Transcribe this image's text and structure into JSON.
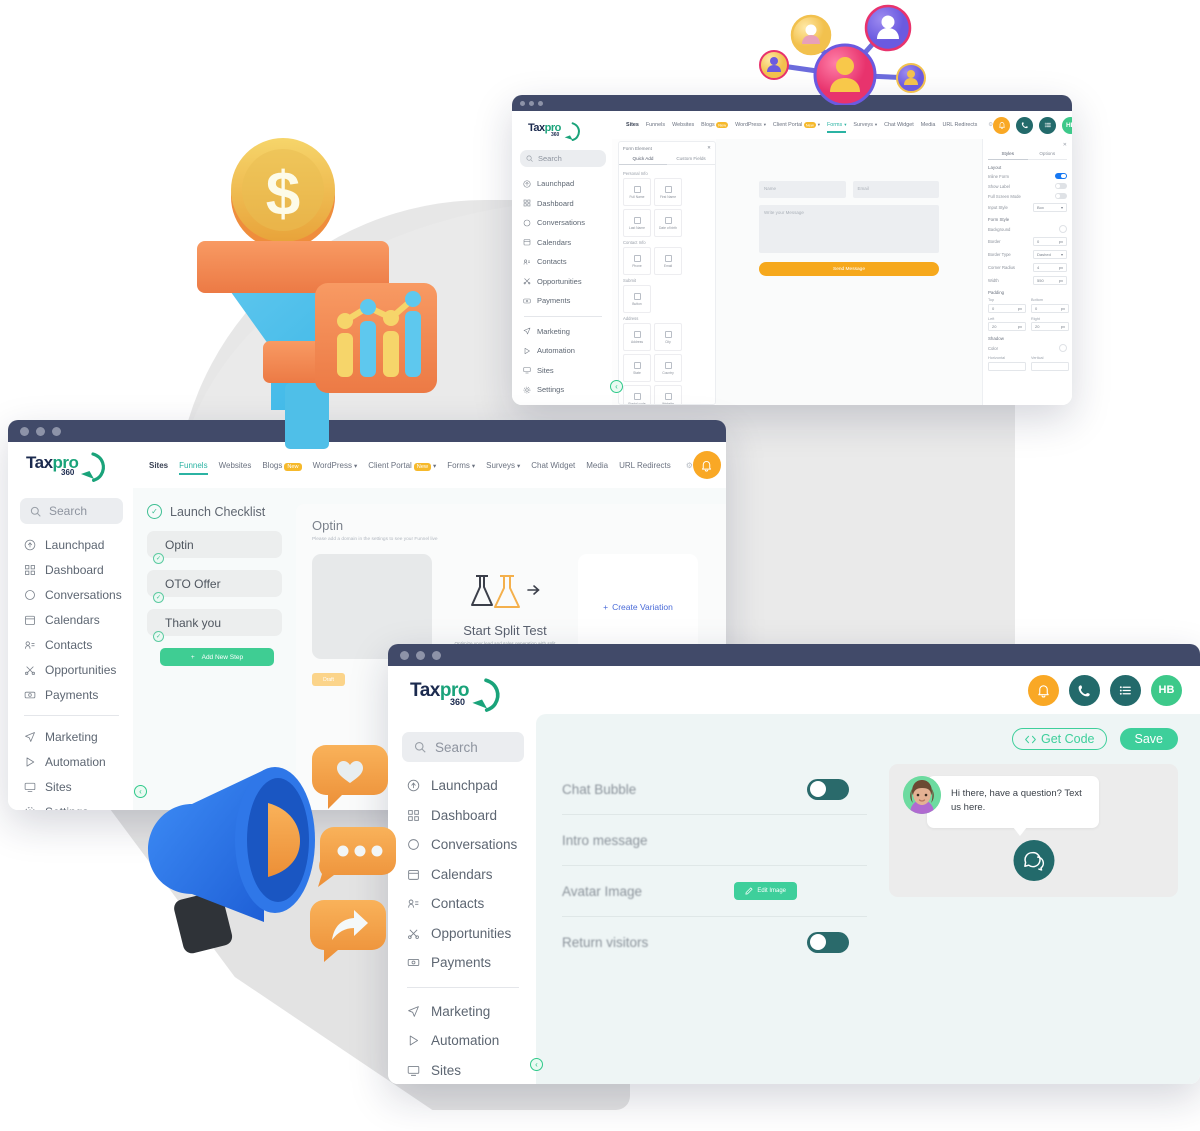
{
  "brand": {
    "logo_tax": "Tax",
    "logo_pro": "pro",
    "logo_num": "360",
    "accent_green": "#3ecf9b",
    "accent_teal": "#236a6b",
    "accent_orange": "#f9a825",
    "titlebar": "#414a69"
  },
  "sidebar": {
    "search_placeholder": "Search",
    "items": [
      {
        "label": "Launchpad",
        "icon": "rocket-icon"
      },
      {
        "label": "Dashboard",
        "icon": "grid-icon"
      },
      {
        "label": "Conversations",
        "icon": "chat-icon"
      },
      {
        "label": "Calendars",
        "icon": "calendar-icon"
      },
      {
        "label": "Contacts",
        "icon": "contacts-icon"
      },
      {
        "label": "Opportunities",
        "icon": "opportunities-icon"
      },
      {
        "label": "Payments",
        "icon": "payments-icon"
      }
    ],
    "items2": [
      {
        "label": "Marketing",
        "icon": "send-icon"
      },
      {
        "label": "Automation",
        "icon": "play-icon"
      },
      {
        "label": "Sites",
        "icon": "monitor-icon"
      },
      {
        "label": "Settings",
        "icon": "gear-icon"
      }
    ],
    "collapse_icon": "chevron-left-icon"
  },
  "header": {
    "bell_icon": "bell-icon",
    "phone_icon": "phone-icon",
    "list_icon": "list-icon",
    "avatar_initials": "HB"
  },
  "site_tabs": [
    {
      "label": "Sites",
      "state": "bold"
    },
    {
      "label": "Funnels",
      "state": "active"
    },
    {
      "label": "Websites",
      "state": "normal"
    },
    {
      "label": "Blogs",
      "state": "normal",
      "badge": "New"
    },
    {
      "label": "WordPress",
      "state": "normal",
      "caret": true
    },
    {
      "label": "Client Portal",
      "state": "normal",
      "badge": "New",
      "caret": true
    },
    {
      "label": "Forms",
      "state": "normal",
      "caret": true
    },
    {
      "label": "Surveys",
      "state": "normal",
      "caret": true
    },
    {
      "label": "Chat Widget",
      "state": "normal"
    },
    {
      "label": "Media",
      "state": "normal"
    },
    {
      "label": "URL Redirects",
      "state": "normal"
    }
  ],
  "site_tabs_back": [
    {
      "label": "Sites",
      "state": "bold"
    },
    {
      "label": "Funnels",
      "state": "normal"
    },
    {
      "label": "Websites",
      "state": "normal"
    },
    {
      "label": "Blogs",
      "state": "normal",
      "badge": "New"
    },
    {
      "label": "WordPress",
      "state": "normal",
      "caret": true
    },
    {
      "label": "Client Portal",
      "state": "normal",
      "badge": "New",
      "caret": true
    },
    {
      "label": "Forms",
      "state": "active",
      "caret": true
    },
    {
      "label": "Surveys",
      "state": "normal",
      "caret": true
    },
    {
      "label": "Chat Widget",
      "state": "normal"
    },
    {
      "label": "Media",
      "state": "normal"
    },
    {
      "label": "URL Redirects",
      "state": "normal"
    }
  ],
  "funnel_window": {
    "checklist_title": "Launch Checklist",
    "steps": [
      {
        "label": "Optin"
      },
      {
        "label": "OTO Offer"
      },
      {
        "label": "Thank you"
      }
    ],
    "add_step_label": "Add New Step",
    "add_step_icon": "plus-icon",
    "page_title": "Optin",
    "page_subtitle": "Please add a domain in the settings to see your Funnel live",
    "split_title": "Start Split Test",
    "split_sub": "Optimize your lead and sales generation with split tests",
    "create_variation": "Create Variation",
    "create_variation_icon": "plus-icon",
    "tag_label": "Draft",
    "split_arrow_icon": "arrow-right-icon",
    "flask_icon": "flask-icon"
  },
  "form_builder": {
    "panel_title": "Form Element",
    "close_icon": "close-icon",
    "tabs": [
      "Quick Add",
      "Custom Fields"
    ],
    "active_tab": "Quick Add",
    "sections": [
      {
        "name": "Personal Info",
        "fields": [
          "Full Name",
          "First Name",
          "Last Name",
          "Date of birth"
        ]
      },
      {
        "name": "Contact Info",
        "fields": [
          "Phone",
          "Email"
        ]
      },
      {
        "name": "Submit",
        "fields": [
          "Button"
        ]
      },
      {
        "name": "Address",
        "fields": [
          "Address",
          "City",
          "State",
          "Country",
          "Postal code",
          "Website"
        ]
      }
    ],
    "preview": {
      "name_placeholder": "Name",
      "email_placeholder": "Email",
      "message_placeholder": "Write your Message",
      "submit_label": "Send Message"
    },
    "styles_panel": {
      "tabs": [
        "Styles",
        "Options"
      ],
      "active_tab": "Styles",
      "layout_heading": "Layout",
      "layout_rows": [
        {
          "label": "Inline Form",
          "type": "switch",
          "value": "on"
        },
        {
          "label": "Show Label",
          "type": "switch",
          "value": "off"
        },
        {
          "label": "Full Screen Mode",
          "type": "switch",
          "value": "off"
        },
        {
          "label": "Input Style",
          "type": "select",
          "value": "Box"
        }
      ],
      "formstyle_heading": "Form Style",
      "formstyle_rows": [
        {
          "label": "Background",
          "type": "color",
          "value": ""
        },
        {
          "label": "Border",
          "type": "num",
          "value": "0",
          "unit": "px"
        },
        {
          "label": "Border Type",
          "type": "select",
          "value": "Dashed"
        },
        {
          "label": "Corner Radius",
          "type": "num",
          "value": "4",
          "unit": "px"
        },
        {
          "label": "Width",
          "type": "num",
          "value": "550",
          "unit": "px"
        }
      ],
      "padding_heading": "Padding",
      "padding": [
        {
          "label": "Top",
          "value": "0",
          "unit": "px"
        },
        {
          "label": "Bottom",
          "value": "0",
          "unit": "px"
        },
        {
          "label": "Left",
          "value": "20",
          "unit": "px"
        },
        {
          "label": "Right",
          "value": "20",
          "unit": "px"
        }
      ],
      "shadow_heading": "Shadow",
      "shadow_rows": [
        {
          "label": "Color"
        },
        {
          "label": "Horizontal"
        },
        {
          "label": "Vertical"
        }
      ]
    }
  },
  "chat_widget": {
    "get_code_label": "Get Code",
    "get_code_icon": "code-brackets-icon",
    "save_label": "Save",
    "fields": [
      {
        "label": "Chat Bubble",
        "control": "toggle",
        "value": "off"
      },
      {
        "label": "Intro message",
        "control": "none"
      },
      {
        "label": "Avatar Image",
        "control": "button",
        "button_label": "Edit Image",
        "button_icon": "pencil-icon"
      },
      {
        "label": "Return visitors",
        "control": "toggle",
        "value": "off"
      }
    ],
    "preview": {
      "message": "Hi there, have a question? Text us here.",
      "avatar_icon": "woman-avatar-icon",
      "fab_icon": "chat-bubbles-icon"
    }
  },
  "illustrations": [
    {
      "name": "network-users-3d"
    },
    {
      "name": "funnel-coin-chart-3d"
    },
    {
      "name": "megaphone-social-3d"
    }
  ]
}
